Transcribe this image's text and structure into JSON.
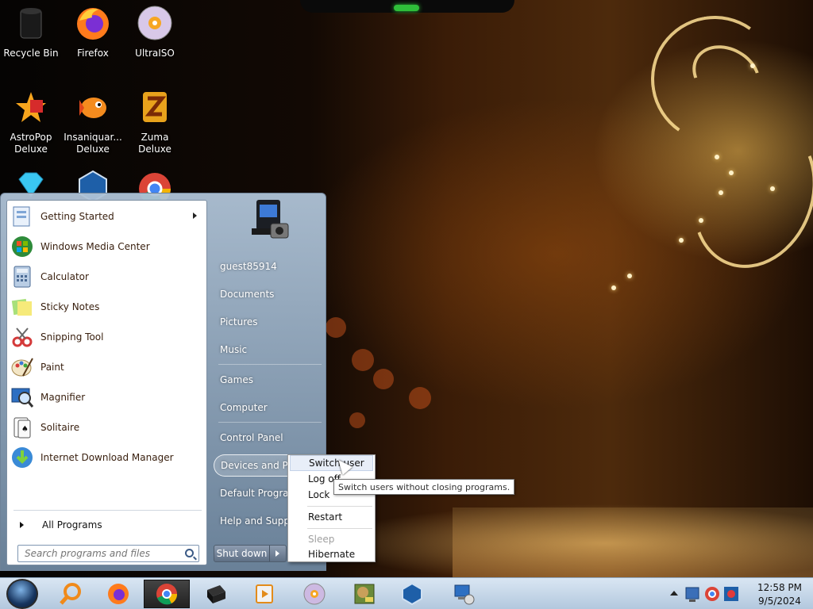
{
  "desktop": {
    "icons": [
      {
        "label": "Recycle Bin",
        "icon": "recycle-bin-icon"
      },
      {
        "label": "Firefox",
        "icon": "firefox-icon"
      },
      {
        "label": "UltraISO",
        "icon": "ultraiso-disc-icon"
      },
      {
        "label": "AstroPop Deluxe",
        "icon": "astropop-icon"
      },
      {
        "label": "Insaniquar... Deluxe",
        "icon": "fish-icon"
      },
      {
        "label": "Zuma Deluxe",
        "icon": "zuma-icon"
      },
      {
        "label": "",
        "icon": "diamond-icon"
      },
      {
        "label": "",
        "icon": "virtualbox-icon"
      },
      {
        "label": "",
        "icon": "chrome-icon"
      }
    ]
  },
  "start_menu": {
    "programs": [
      {
        "label": "Getting Started",
        "icon": "getting-started-icon",
        "has_submenu": true
      },
      {
        "label": "Windows Media Center",
        "icon": "media-center-icon"
      },
      {
        "label": "Calculator",
        "icon": "calculator-icon"
      },
      {
        "label": "Sticky Notes",
        "icon": "sticky-notes-icon"
      },
      {
        "label": "Snipping Tool",
        "icon": "snipping-tool-icon"
      },
      {
        "label": "Paint",
        "icon": "paint-icon"
      },
      {
        "label": "Magnifier",
        "icon": "magnifier-icon"
      },
      {
        "label": "Solitaire",
        "icon": "solitaire-icon"
      },
      {
        "label": "Internet Download Manager",
        "icon": "idm-icon"
      }
    ],
    "all_programs": "All Programs",
    "search_placeholder": "Search programs and files",
    "user_name": "guest85914",
    "right_items": [
      "Documents",
      "Pictures",
      "Music",
      "Games",
      "Computer",
      "Control Panel",
      "Devices and Printers",
      "Default Programs",
      "Help and Support"
    ],
    "shutdown_label": "Shut down"
  },
  "power_menu": {
    "items": [
      {
        "label": "Switch user",
        "state": "active"
      },
      {
        "label": "Log off",
        "state": "normal"
      },
      {
        "label": "Lock",
        "state": "normal"
      },
      {
        "label": "Restart",
        "state": "normal"
      },
      {
        "label": "Sleep",
        "state": "disabled"
      },
      {
        "label": "Hibernate",
        "state": "normal"
      }
    ],
    "tooltip": "Switch users without closing programs."
  },
  "taskbar": {
    "buttons": [
      {
        "icon": "search-icon"
      },
      {
        "icon": "firefox-icon"
      },
      {
        "icon": "chrome-icon",
        "active": true
      },
      {
        "icon": "black-box-icon"
      },
      {
        "icon": "media-player-icon"
      },
      {
        "icon": "disc-icon"
      },
      {
        "icon": "box-game-icon"
      },
      {
        "icon": "virtualbox-icon"
      },
      {
        "icon": "network-computer-icon"
      }
    ],
    "clock_time": "12:58 PM",
    "clock_date": "9/5/2024"
  },
  "colors": {
    "program_text": "#3a2110",
    "menu_frame": "#8ba2bb",
    "taskbar": "#c5d6e8"
  }
}
